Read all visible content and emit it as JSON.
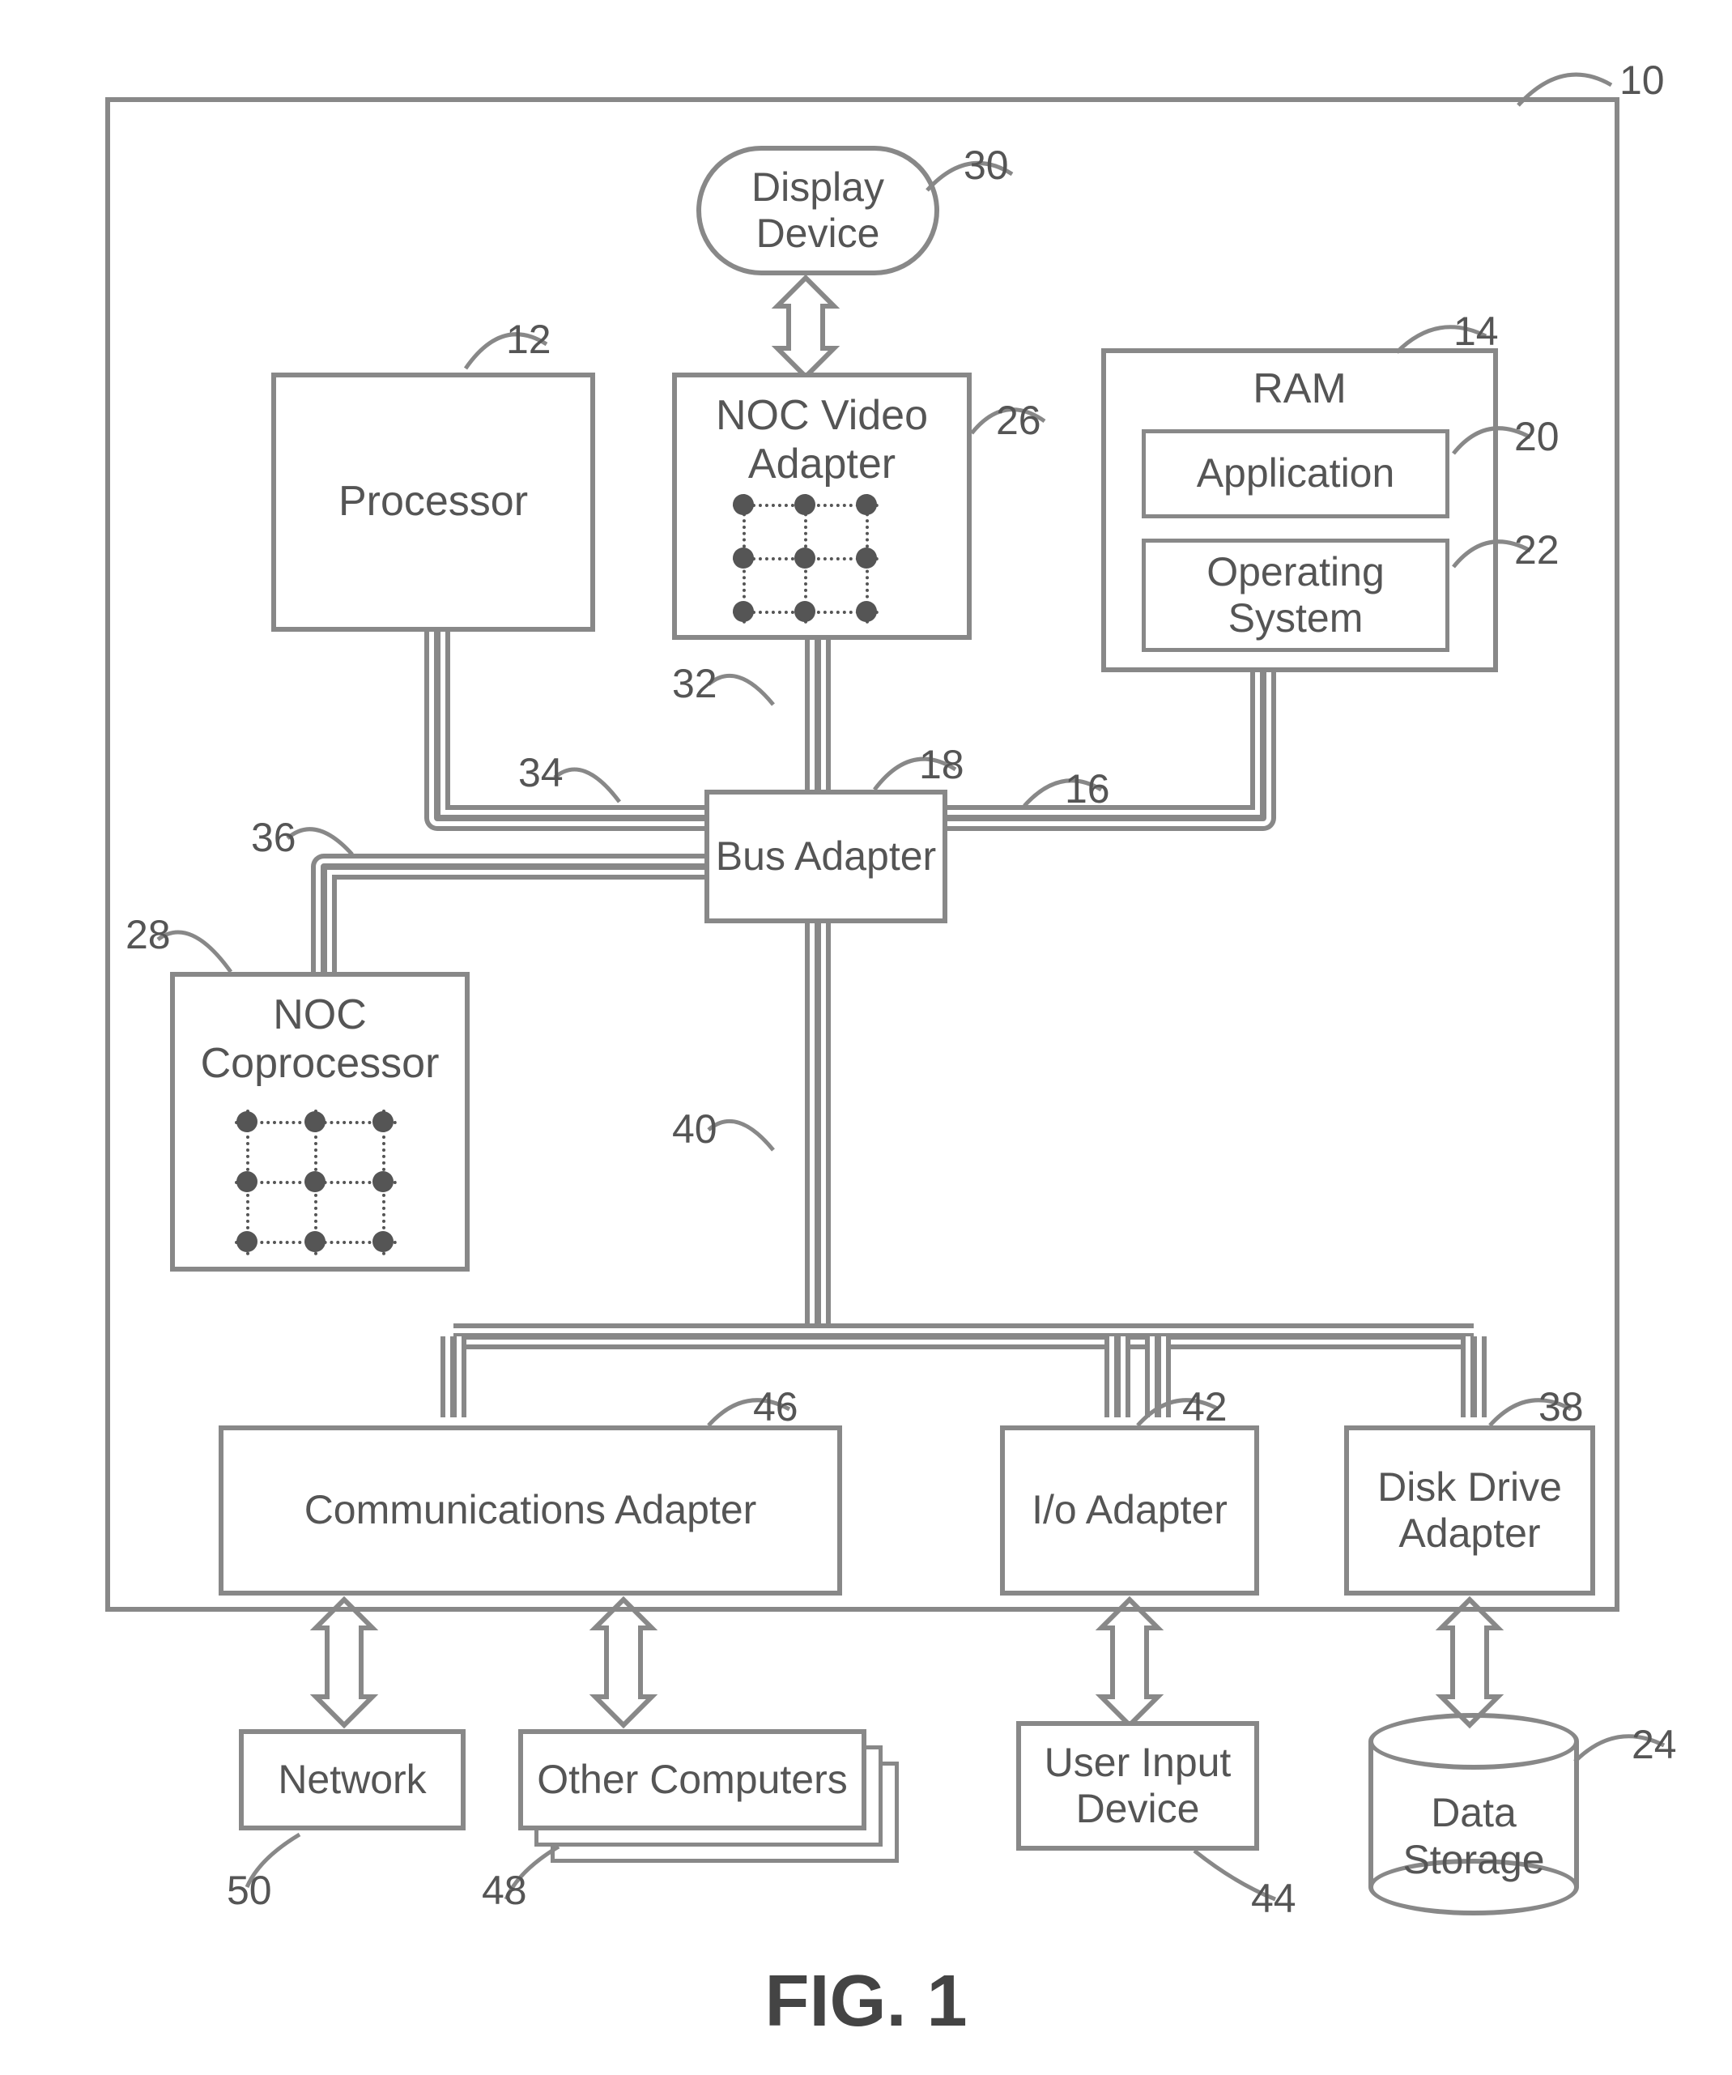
{
  "figure_caption": "FIG. 1",
  "refs": {
    "computer": "10",
    "processor": "12",
    "ram": "14",
    "mem_bus": "16",
    "bus_adapter": "18",
    "application": "20",
    "os": "22",
    "data_storage": "24",
    "noc_video": "26",
    "noc_coproc": "28",
    "display": "30",
    "video_bus": "32",
    "fsb": "34",
    "coproc_bus": "36",
    "disk_adapter": "38",
    "exp_bus": "40",
    "io_adapter": "42",
    "user_input": "44",
    "comm_adapter": "46",
    "other_computers": "48",
    "network": "50"
  },
  "labels": {
    "display": "Display\nDevice",
    "processor": "Processor",
    "noc_video": "NOC Video\nAdapter",
    "ram": "RAM",
    "application": "Application",
    "os": "Operating\nSystem",
    "bus_adapter": "Bus Adapter",
    "noc_coproc": "NOC\nCoprocessor",
    "comm_adapter": "Communications Adapter",
    "io_adapter": "I/o Adapter",
    "disk_adapter": "Disk Drive\nAdapter",
    "network": "Network",
    "other_computers": "Other Computers",
    "user_input": "User Input\nDevice",
    "data_storage": "Data\nStorage"
  }
}
